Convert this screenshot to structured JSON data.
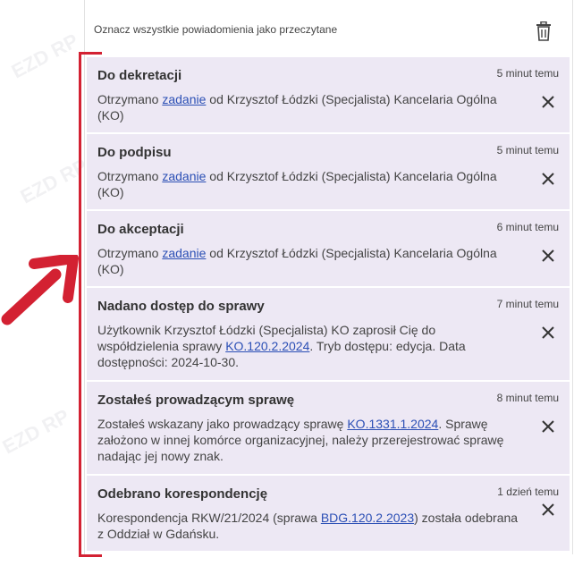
{
  "header": {
    "mark_all_label": "Oznacz wszystkie powiadomienia jako przeczytane"
  },
  "notifications": [
    {
      "title": "Do dekretacji",
      "time": "5 minut temu",
      "body_before": "Otrzymano ",
      "link": "zadanie",
      "body_after": " od Krzysztof Łódzki (Specjalista) Kancelaria Ogólna (KO)"
    },
    {
      "title": "Do podpisu",
      "time": "5 minut temu",
      "body_before": "Otrzymano ",
      "link": "zadanie",
      "body_after": " od Krzysztof Łódzki (Specjalista) Kancelaria Ogólna (KO)"
    },
    {
      "title": "Do akceptacji",
      "time": "6 minut temu",
      "body_before": "Otrzymano ",
      "link": "zadanie",
      "body_after": " od Krzysztof Łódzki (Specjalista) Kancelaria Ogólna (KO)"
    },
    {
      "title": "Nadano dostęp do sprawy",
      "time": "7 minut temu",
      "body_before": "Użytkownik Krzysztof Łódzki (Specjalista) KO zaprosił Cię do współdzielenia sprawy ",
      "link": "KO.120.2.2024",
      "body_after": ". Tryb dostępu: edycja. Data dostępności: 2024-10-30."
    },
    {
      "title": "Zostałeś prowadzącym sprawę",
      "time": "8 minut temu",
      "body_before": "Zostałeś wskazany jako prowadzący sprawę ",
      "link": "KO.1331.1.2024",
      "body_after": ". Sprawę założono w innej komórce organizacyjnej, należy przerejestrować sprawę nadając jej nowy znak."
    },
    {
      "title": "Odebrano korespondencję",
      "time": "1 dzień temu",
      "body_before": "Korespondencja RKW/21/2024 (sprawa ",
      "link": "BDG.120.2.2023",
      "body_after": ") została odebrana z Oddział w Gdańsku."
    }
  ],
  "colors": {
    "item_bg": "#ede8f4",
    "link": "#2b4fb5",
    "annotation": "#d32132"
  },
  "icons": {
    "delete_all": "trash-icon",
    "dismiss": "close-icon"
  }
}
